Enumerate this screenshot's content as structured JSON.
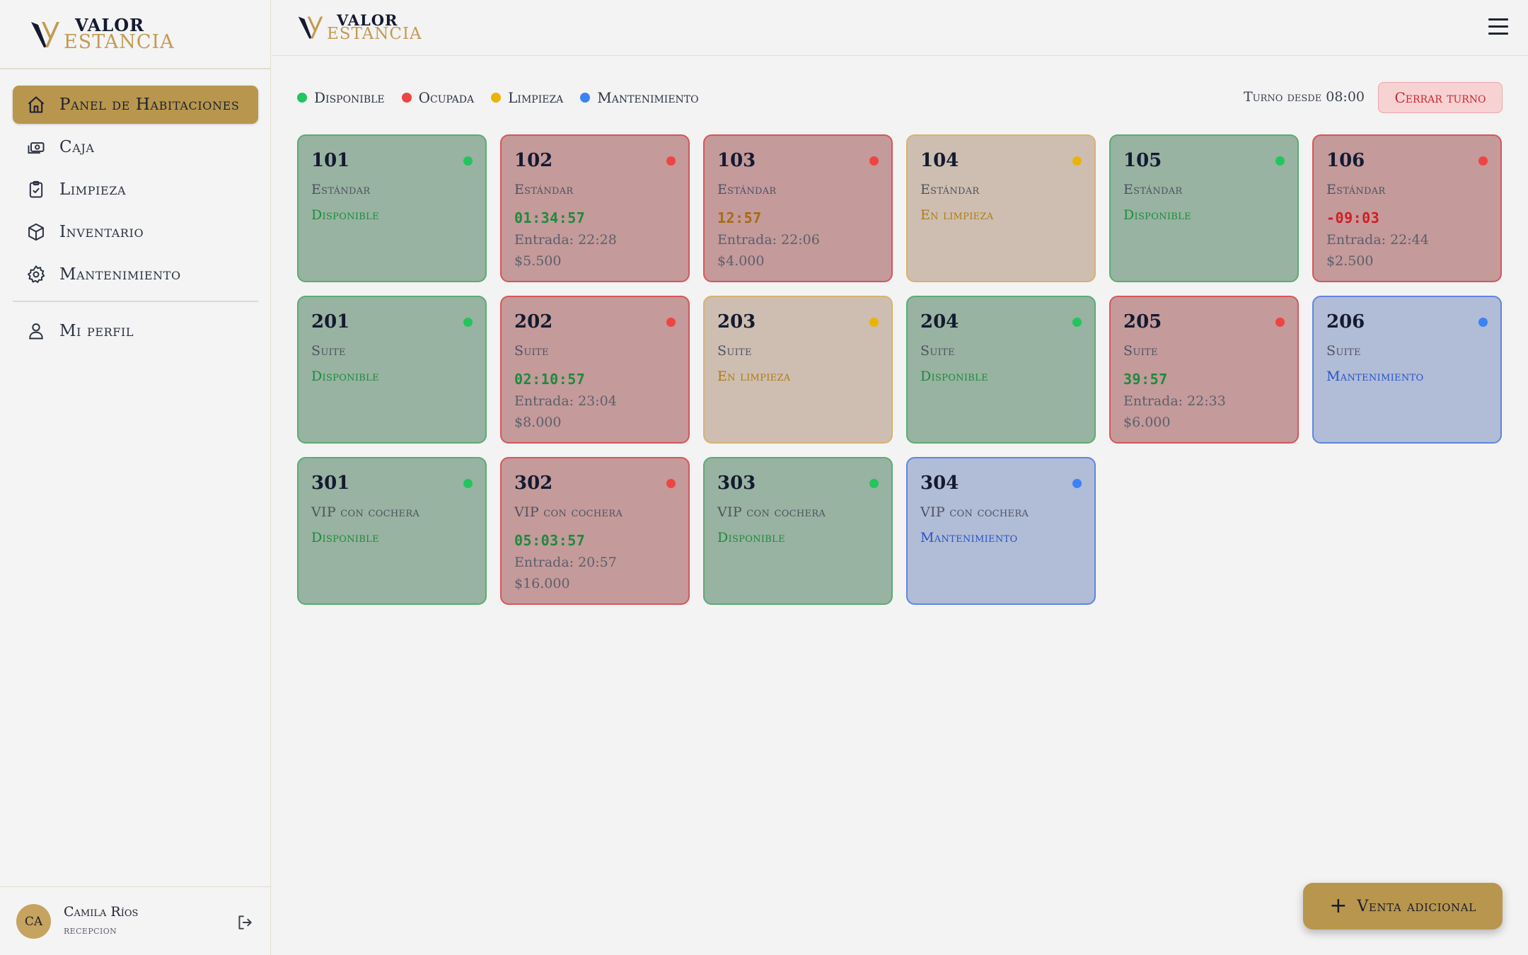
{
  "brand": {
    "line1": "VALOR",
    "line2": "ESTANCIA"
  },
  "sidebar": {
    "items": [
      {
        "label": "Panel de Habitaciones",
        "icon": "home-icon",
        "active": true
      },
      {
        "label": "Caja",
        "icon": "cash-icon",
        "active": false
      },
      {
        "label": "Limpieza",
        "icon": "clipboard-check-icon",
        "active": false
      },
      {
        "label": "Inventario",
        "icon": "box-icon",
        "active": false
      },
      {
        "label": "Mantenimiento",
        "icon": "gear-icon",
        "active": false
      }
    ],
    "profile": {
      "label": "Mi perfil",
      "icon": "user-icon"
    },
    "user": {
      "initials": "CA",
      "name": "Camila Ríos",
      "role": "recepcion"
    }
  },
  "legend": [
    {
      "label": "Disponible",
      "color": "#22c55e"
    },
    {
      "label": "Ocupada",
      "color": "#ef4444"
    },
    {
      "label": "Limpieza",
      "color": "#eab308"
    },
    {
      "label": "Mantenimiento",
      "color": "#3b82f6"
    }
  ],
  "shift": {
    "label": "Turno desde 08:00",
    "close_label": "Cerrar turno"
  },
  "colors": {
    "accent": "#b8964d",
    "disponible": "#22c55e",
    "ocupada": "#ef4444",
    "limpieza": "#eab308",
    "mantenimiento": "#3b82f6"
  },
  "rooms": [
    {
      "number": "101",
      "type": "Estándar",
      "status": "disponible",
      "state_label": "Disponible"
    },
    {
      "number": "102",
      "type": "Estándar",
      "status": "ocupada",
      "timer": "01:34:57",
      "timer_state": "ok",
      "entry": "Entrada: 22:28",
      "price": "$5.500"
    },
    {
      "number": "103",
      "type": "Estándar",
      "status": "ocupada",
      "timer": "12:57",
      "timer_state": "warn",
      "entry": "Entrada: 22:06",
      "price": "$4.000"
    },
    {
      "number": "104",
      "type": "Estándar",
      "status": "limpieza",
      "state_label": "En limpieza"
    },
    {
      "number": "105",
      "type": "Estándar",
      "status": "disponible",
      "state_label": "Disponible"
    },
    {
      "number": "106",
      "type": "Estándar",
      "status": "ocupada",
      "timer": "-09:03",
      "timer_state": "over",
      "entry": "Entrada: 22:44",
      "price": "$2.500"
    },
    {
      "number": "201",
      "type": "Suite",
      "status": "disponible",
      "state_label": "Disponible"
    },
    {
      "number": "202",
      "type": "Suite",
      "status": "ocupada",
      "timer": "02:10:57",
      "timer_state": "ok",
      "entry": "Entrada: 23:04",
      "price": "$8.000"
    },
    {
      "number": "203",
      "type": "Suite",
      "status": "limpieza",
      "state_label": "En limpieza"
    },
    {
      "number": "204",
      "type": "Suite",
      "status": "disponible",
      "state_label": "Disponible"
    },
    {
      "number": "205",
      "type": "Suite",
      "status": "ocupada",
      "timer": "39:57",
      "timer_state": "ok",
      "entry": "Entrada: 22:33",
      "price": "$6.000"
    },
    {
      "number": "206",
      "type": "Suite",
      "status": "mantenimiento",
      "state_label": "Mantenimiento"
    },
    {
      "number": "301",
      "type": "VIP con cochera",
      "status": "disponible",
      "state_label": "Disponible"
    },
    {
      "number": "302",
      "type": "VIP con cochera",
      "status": "ocupada",
      "timer": "05:03:57",
      "timer_state": "ok",
      "entry": "Entrada: 20:57",
      "price": "$16.000"
    },
    {
      "number": "303",
      "type": "VIP con cochera",
      "status": "disponible",
      "state_label": "Disponible"
    },
    {
      "number": "304",
      "type": "VIP con cochera",
      "status": "mantenimiento",
      "state_label": "Mantenimiento"
    }
  ],
  "fab": {
    "label": "Venta adicional",
    "icon": "plus-icon"
  },
  "topbar": {
    "menu_icon": "hamburger-menu-icon"
  }
}
